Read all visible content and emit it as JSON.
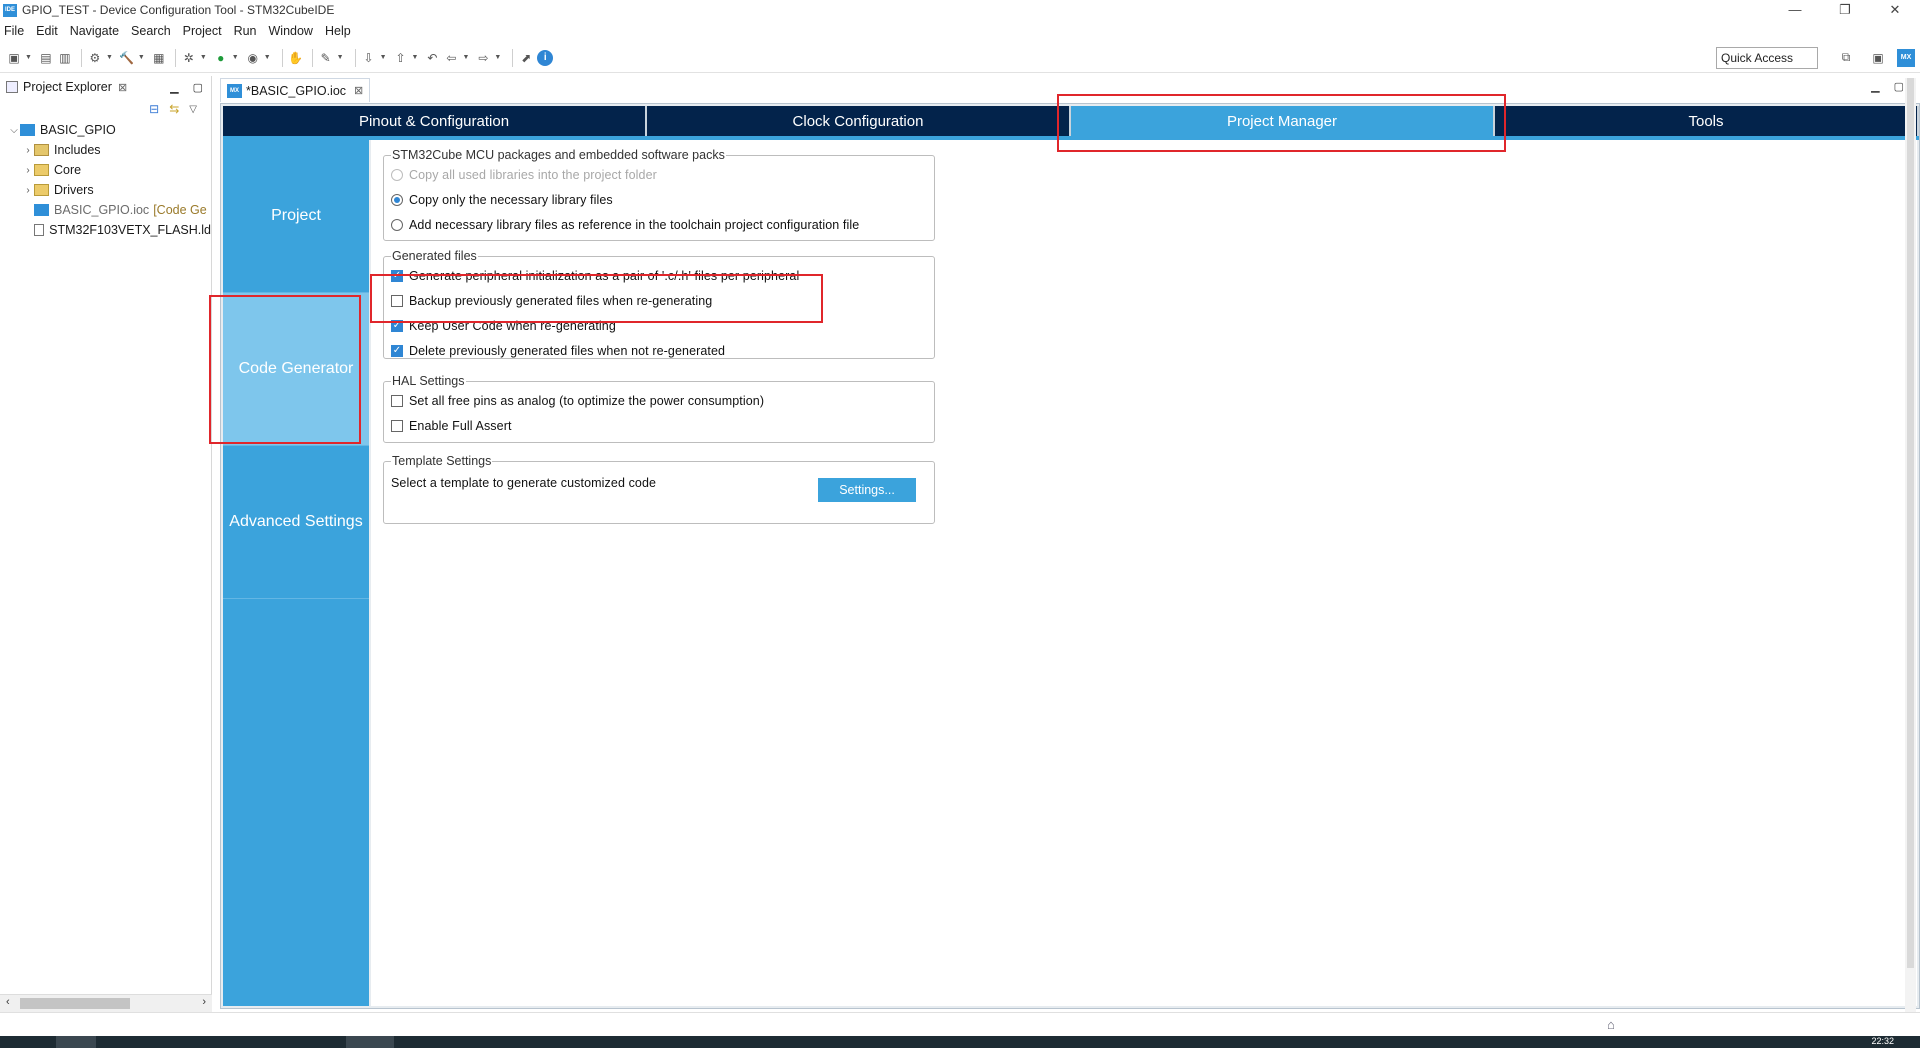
{
  "window": {
    "title": "GPIO_TEST - Device Configuration Tool - STM32CubeIDE",
    "app_icon": "IDE"
  },
  "menu": [
    "File",
    "Edit",
    "Navigate",
    "Search",
    "Project",
    "Run",
    "Window",
    "Help"
  ],
  "toolbar": {
    "quick_access": "Quick Access",
    "mx_badge": "MX"
  },
  "explorer": {
    "title": "Project Explorer",
    "tree": [
      {
        "label": "BASIC_GPIO",
        "icon": "project-icon"
      },
      {
        "label": "Includes",
        "icon": "includes-icon"
      },
      {
        "label": "Core",
        "icon": "folder-icon"
      },
      {
        "label": "Drivers",
        "icon": "folder-icon"
      },
      {
        "label": "BASIC_GPIO.ioc",
        "decoration": "[Code Ge",
        "icon": "ioc-file-icon"
      },
      {
        "label": "STM32F103VETX_FLASH.ld",
        "icon": "linker-file-icon"
      }
    ]
  },
  "editor": {
    "tab_label": "*BASIC_GPIO.ioc",
    "tab_icon": "MX",
    "top_tabs": [
      "Pinout & Configuration",
      "Clock Configuration",
      "Project Manager",
      "Tools"
    ],
    "active_top_tab": "Project Manager",
    "left_nav": [
      "Project",
      "Code Generator",
      "Advanced Settings"
    ],
    "active_left_nav": "Code Generator"
  },
  "code_generator": {
    "packages": {
      "legend": "STM32Cube MCU packages and embedded software packs",
      "options": [
        {
          "label": "Copy all used libraries into the project folder",
          "selected": false,
          "disabled": true
        },
        {
          "label": "Copy only the necessary library files",
          "selected": true,
          "disabled": false
        },
        {
          "label": "Add necessary library files as reference in the toolchain project configuration file",
          "selected": false,
          "disabled": false
        }
      ]
    },
    "generated_files": {
      "legend": "Generated files",
      "options": [
        {
          "label": "Generate peripheral initialization as a pair of '.c/.h' files per peripheral",
          "checked": true
        },
        {
          "label": "Backup previously generated files when re-generating",
          "checked": false
        },
        {
          "label": "Keep User Code when re-generating",
          "checked": true
        },
        {
          "label": "Delete previously generated files when not re-generated",
          "checked": true
        }
      ]
    },
    "hal_settings": {
      "legend": "HAL Settings",
      "options": [
        {
          "label": "Set all free pins as analog (to optimize the power consumption)",
          "checked": false
        },
        {
          "label": "Enable Full Assert",
          "checked": false
        }
      ]
    },
    "template_settings": {
      "legend": "Template Settings",
      "description": "Select a template to generate customized code",
      "button_label": "Settings..."
    }
  },
  "taskbar": {
    "clock": "22:32"
  },
  "colors": {
    "accent": "#3ba3dc",
    "nav_dark": "#03234b",
    "nav_active": "#7ec6ec",
    "highlight": "#e0262b",
    "checkbox": "#2f86d4"
  }
}
